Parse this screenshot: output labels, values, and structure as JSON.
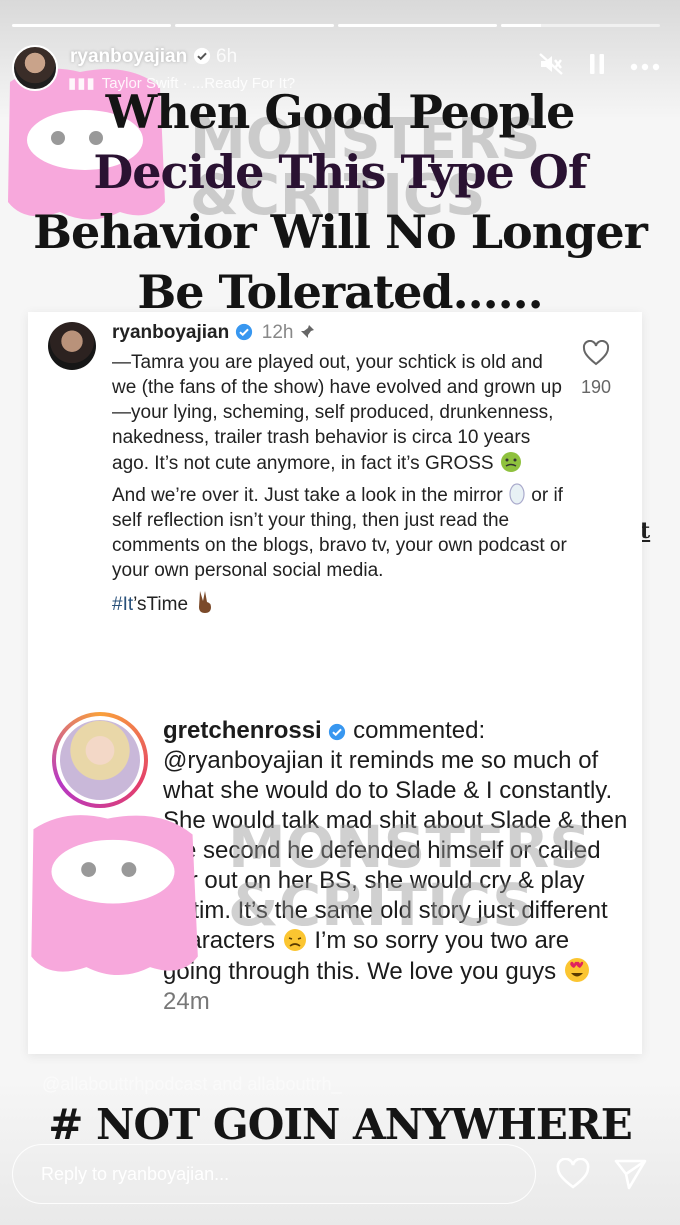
{
  "header": {
    "username": "ryanboyajian",
    "time_ago": "6h",
    "music": "Taylor Swift · ...Ready For It?"
  },
  "progress": {
    "segments": [
      1,
      1,
      1,
      0.25
    ]
  },
  "headline": {
    "line1": "When Good People",
    "line2": "Decide This Type Of",
    "line3": "Behavior Will No Longer",
    "line4": "Be Tolerated......"
  },
  "watermark": {
    "line1": "MONSTERS",
    "line2": "&CRITICS"
  },
  "edge_char": "t",
  "post": {
    "username": "ryanboyajian",
    "time": "12h",
    "likes": "190",
    "para1": "—Tamra you are played out, your schtick is old and we (the fans of the show) have evolved and grown up—your lying, scheming, self produced, drunkenness, nakedness, trailer trash behavior is circa 10 years ago. It’s not cute anymore, in fact it’s GROSS",
    "para2a": "And we’re over it. Just take a look in the mirror",
    "para2b": "or if self reflection isn’t your thing, then just read the comments on the blogs, bravo tv, your own podcast or your own personal social media.",
    "hashtag": "#It",
    "hashtag_rest": "’sTime"
  },
  "comment": {
    "username": "gretchenrossi",
    "action": "commented:",
    "text": "@ryanboyajian it reminds me so much of what she would do  to Slade & I constantly. She would talk mad shit about Slade & then the second he defended himself or called her out on her BS, she would cry & play victim. It’s the same old story just different characters",
    "text2": "I’m so sorry you two are going through this. We love you guys",
    "time": "24m"
  },
  "mentions": "@allabouttrhpodcast and allabouttrh_",
  "bottom_tag": "# NOT GOIN ANYWHERE",
  "reply": {
    "placeholder": "Reply to ryanboyajian..."
  },
  "colors": {
    "watermark_pink": "#f7a8dc",
    "verified_blue": "#3897f0",
    "hashtag_blue": "#28507a"
  }
}
